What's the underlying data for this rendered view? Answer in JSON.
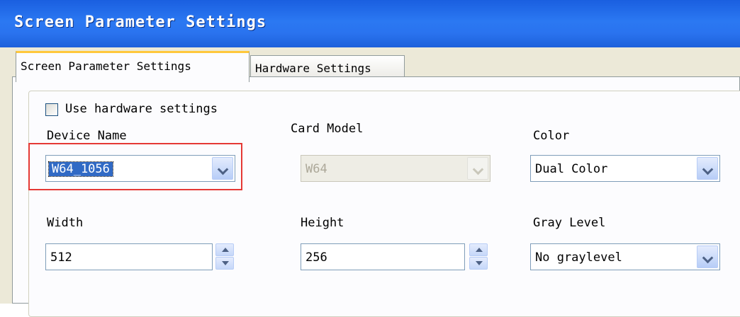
{
  "window": {
    "title": "Screen Parameter Settings"
  },
  "tabs": [
    {
      "label": "Screen Parameter Settings",
      "active": true
    },
    {
      "label": "Hardware Settings",
      "active": false
    }
  ],
  "form": {
    "use_hardware_settings": {
      "label": "Use hardware settings",
      "checked": false
    },
    "device_name": {
      "label": "Device Name",
      "value": "W64_1056"
    },
    "card_model": {
      "label": "Card Model",
      "value": "W64",
      "disabled": true
    },
    "color": {
      "label": "Color",
      "value": "Dual Color"
    },
    "width": {
      "label": "Width",
      "value": "512"
    },
    "height": {
      "label": "Height",
      "value": "256"
    },
    "gray_level": {
      "label": "Gray Level",
      "value": "No graylevel"
    }
  },
  "colors": {
    "titlebar": "#2a73ef",
    "highlight_box": "#e53935",
    "selection": "#316ac5",
    "tab_active_accent": "#ffc83c"
  },
  "icons": [
    "chevron-down-icon",
    "spin-up-icon",
    "spin-down-icon",
    "checkbox-icon"
  ]
}
